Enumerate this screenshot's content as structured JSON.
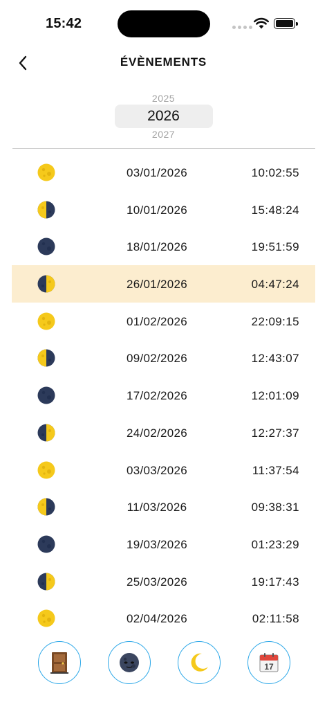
{
  "status": {
    "time": "15:42"
  },
  "nav": {
    "title": "ÉVÈNEMENTS"
  },
  "year_picker": {
    "previous": "2025",
    "selected": "2026",
    "next": "2027"
  },
  "events": [
    {
      "phase": "full-moon",
      "date": "03/01/2026",
      "time": "10:02:55",
      "highlighted": false
    },
    {
      "phase": "last-quarter",
      "date": "10/01/2026",
      "time": "15:48:24",
      "highlighted": false
    },
    {
      "phase": "new-moon",
      "date": "18/01/2026",
      "time": "19:51:59",
      "highlighted": false
    },
    {
      "phase": "first-quarter",
      "date": "26/01/2026",
      "time": "04:47:24",
      "highlighted": true
    },
    {
      "phase": "full-moon",
      "date": "01/02/2026",
      "time": "22:09:15",
      "highlighted": false
    },
    {
      "phase": "last-quarter",
      "date": "09/02/2026",
      "time": "12:43:07",
      "highlighted": false
    },
    {
      "phase": "new-moon",
      "date": "17/02/2026",
      "time": "12:01:09",
      "highlighted": false
    },
    {
      "phase": "first-quarter",
      "date": "24/02/2026",
      "time": "12:27:37",
      "highlighted": false
    },
    {
      "phase": "full-moon",
      "date": "03/03/2026",
      "time": "11:37:54",
      "highlighted": false
    },
    {
      "phase": "last-quarter",
      "date": "11/03/2026",
      "time": "09:38:31",
      "highlighted": false
    },
    {
      "phase": "new-moon",
      "date": "19/03/2026",
      "time": "01:23:29",
      "highlighted": false
    },
    {
      "phase": "first-quarter",
      "date": "25/03/2026",
      "time": "19:17:43",
      "highlighted": false
    },
    {
      "phase": "full-moon",
      "date": "02/04/2026",
      "time": "02:11:58",
      "highlighted": false
    }
  ],
  "tabs": [
    {
      "icon": "door-icon"
    },
    {
      "icon": "new-moon-face-icon"
    },
    {
      "icon": "crescent-moon-icon"
    },
    {
      "icon": "calendar-icon",
      "day": "17"
    }
  ],
  "colors": {
    "highlight_row": "#fcedcf",
    "tab_border": "#2aa7e8",
    "moon_light": "#f5c91b",
    "moon_dark": "#2c3a5a"
  }
}
